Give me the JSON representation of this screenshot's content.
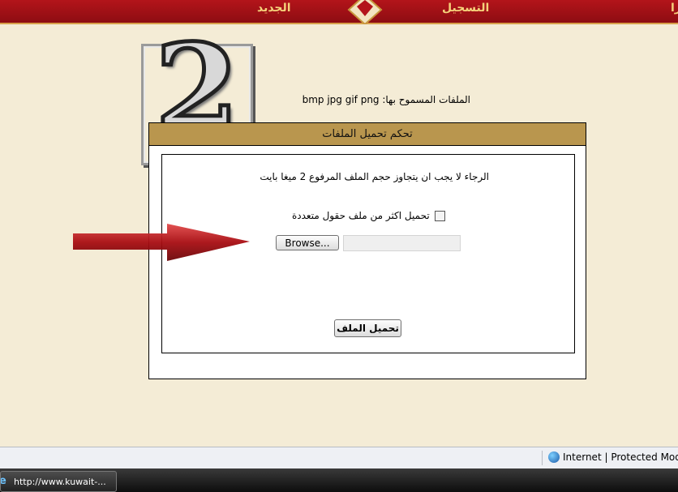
{
  "nav": {
    "register": "التسجيل",
    "new": "الجديد",
    "partial": "را"
  },
  "step_badge": "2",
  "allowed_files": "الملفات المسموح بها:  bmp  jpg  gif  png",
  "panel": {
    "title": "تحكم تحميل الملفات",
    "size_note": "الرجاء لا يجب ان يتجاوز حجم الملف المرفوع 2 ميغا بايت",
    "multi_label": "تحميل اكثر من ملف حقول متعددة",
    "browse_label": "Browse...",
    "file_value": "",
    "upload_label": "تحميل الملف"
  },
  "status": {
    "zone": "Internet | Protected Mode:"
  },
  "taskbar": {
    "item": "http://www.kuwait-..."
  },
  "colors": {
    "page_bg": "#f4ecd6",
    "nav_red": "#b3141a",
    "nav_text": "#f5d27a",
    "panel_header": "#b9964e",
    "arrow": "#c0141a"
  }
}
